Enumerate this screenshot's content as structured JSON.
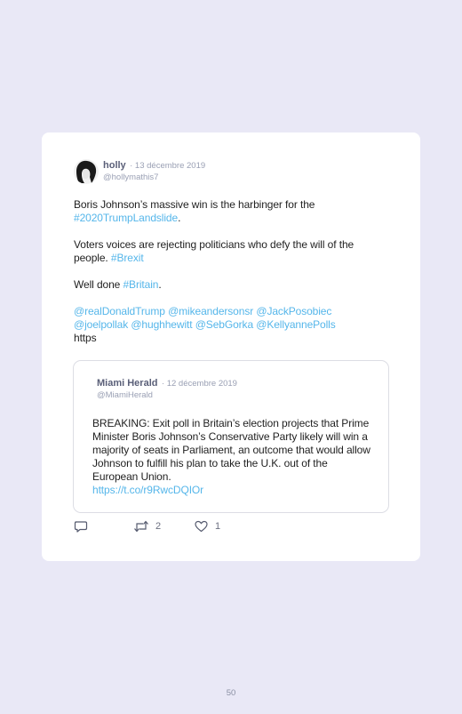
{
  "tweet": {
    "name": "holly",
    "date": "· 13 décembre 2019",
    "handle": "@hollymathis7",
    "line1": "Boris Johnson’s massive win is the harbinger for the",
    "hashtag1": "#2020TrumpLandslide",
    "line1_end": ".",
    "line2": "Voters voices are rejecting politicians who defy the will of the people.",
    "hashtag2": "#Brexit",
    "line3": "Well done",
    "hashtag3": "#Britain",
    "line3_end": ".",
    "mentions": "@realDonaldTrump @mikeandersonsr @JackPosobiec @joelpollak @hughhewitt @SebGorka @KellyannePolls",
    "trailing": "https"
  },
  "quoted": {
    "name": "Miami Herald",
    "date": "· 12 décembre 2019",
    "handle": "@MiamiHerald",
    "text": "BREAKING: Exit poll in Britain’s election projects that Prime Minister Boris Johnson’s Conservative Party likely will win a majority of seats in Parliament, an outcome that would allow Johnson to fulfill his plan to take the U.K. out of the European Union.",
    "link": "https://t.co/r9RwcDQIOr"
  },
  "actions": {
    "reply_icon": "reply-icon",
    "retweet_icon": "retweet-icon",
    "retweet_count": "2",
    "like_icon": "heart-icon",
    "like_count": "1"
  },
  "page_number": "50",
  "colors": {
    "background": "#e9e8f6",
    "card": "#ffffff",
    "link": "#55b6ea"
  }
}
